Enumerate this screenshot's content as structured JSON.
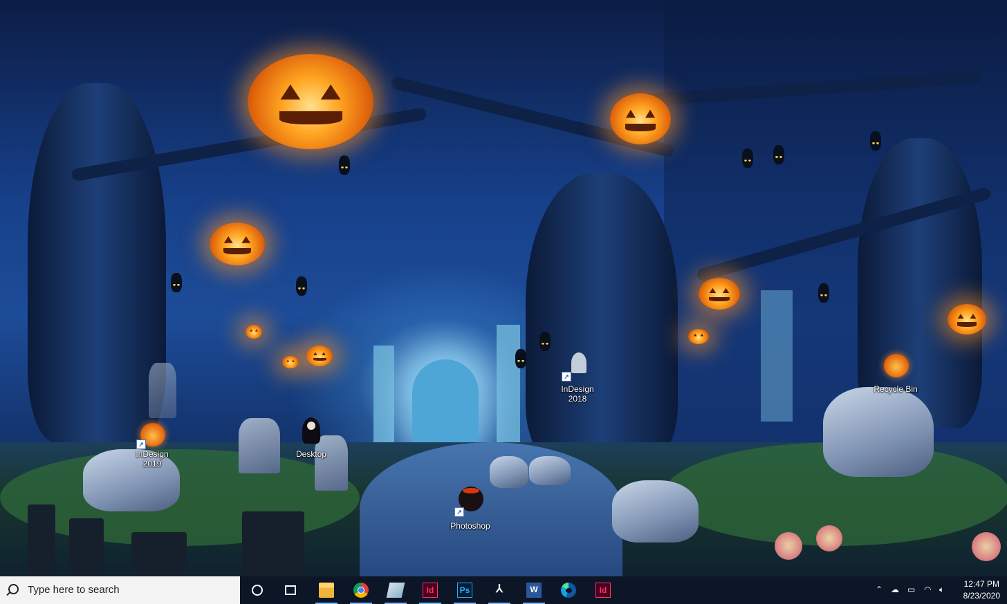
{
  "desktop": {
    "icons": [
      {
        "label": "InDesign\n2019",
        "icon": "pumpkin-icon"
      },
      {
        "label": "Desktop",
        "icon": "reaper-icon"
      },
      {
        "label": "InDesign\n2018",
        "icon": "ghost-icon"
      },
      {
        "label": "Photoshop",
        "icon": "cauldron-icon"
      },
      {
        "label": "Recycle Bin",
        "icon": "pumpkin-icon"
      }
    ]
  },
  "taskbar": {
    "search_placeholder": "Type here to search",
    "apps": [
      {
        "name": "Cortana",
        "icon": "cortana-icon",
        "running": false
      },
      {
        "name": "Task View",
        "icon": "task-view-icon",
        "running": false
      },
      {
        "name": "File Explorer",
        "icon": "folder-icon",
        "running": true
      },
      {
        "name": "Google Chrome",
        "icon": "chrome-icon",
        "running": true
      },
      {
        "name": "Tablet",
        "icon": "tablet-icon",
        "running": true
      },
      {
        "name": "InDesign",
        "glyph": "Id",
        "icon": "indesign-icon",
        "running": true
      },
      {
        "name": "Photoshop",
        "glyph": "Ps",
        "icon": "photoshop-icon",
        "running": true
      },
      {
        "name": "Acrobat",
        "icon": "acrobat-icon",
        "running": true
      },
      {
        "name": "Word",
        "glyph": "W",
        "icon": "word-icon",
        "running": true
      },
      {
        "name": "Edge",
        "icon": "edge-icon",
        "running": false
      },
      {
        "name": "InDesign 2018",
        "glyph": "Id",
        "icon": "indesign-icon",
        "running": false
      }
    ],
    "tray": {
      "time": "12:47 PM",
      "date": "8/23/2020"
    }
  }
}
